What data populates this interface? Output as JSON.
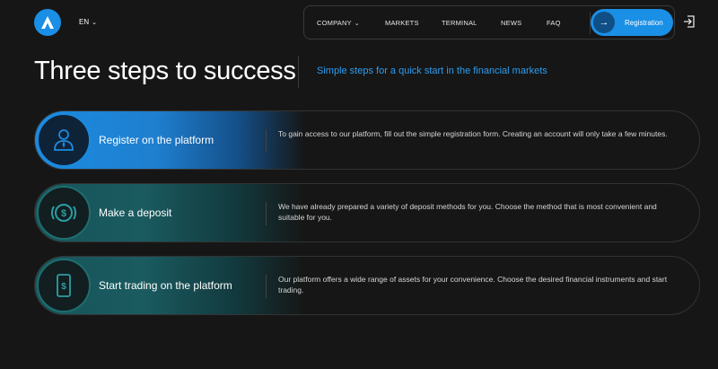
{
  "header": {
    "lang": "EN",
    "nav": [
      {
        "label": "COMPANY",
        "has_dropdown": true
      },
      {
        "label": "MARKETS"
      },
      {
        "label": "TERMINAL"
      },
      {
        "label": "NEWS"
      },
      {
        "label": "FAQ"
      }
    ],
    "registration_label": "Registration",
    "icons": {
      "logo": "logo-a-icon",
      "register_arrow": "arrow-right-icon",
      "login": "login-icon"
    }
  },
  "hero": {
    "title": "Three steps to success",
    "subtitle": "Simple steps for a quick start in the financial markets"
  },
  "steps": [
    {
      "title": "Register on the platform",
      "description": "To gain access to our platform, fill out the simple registration form. Creating an account will only take a few minutes.",
      "icon": "user-profile-icon",
      "active": true
    },
    {
      "title": "Make a deposit",
      "description": "We have already prepared a variety of deposit methods for you. Choose the method that is most convenient and suitable for you.",
      "icon": "coin-dollar-icon",
      "active": false
    },
    {
      "title": "Start trading on the platform",
      "description": "Our platform offers a wide range of assets for your convenience. Choose the desired financial instruments and start trading.",
      "icon": "mobile-dollar-icon",
      "active": false
    }
  ],
  "colors": {
    "background": "#161616",
    "accent": "#1a8fe6",
    "subtitle": "#2c9df2",
    "teal": "#1a5b60"
  }
}
